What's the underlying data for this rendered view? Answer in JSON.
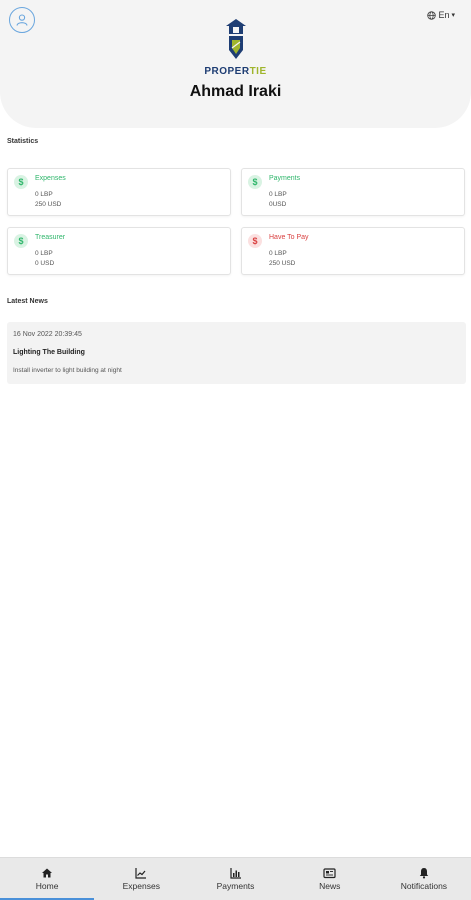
{
  "header": {
    "language": "En",
    "brand_part1": "PROPER",
    "brand_part2": "TIE",
    "username": "Ahmad Iraki"
  },
  "statistics": {
    "title": "Statistics",
    "cards": [
      {
        "icon": "dollar-icon",
        "label": "Expenses",
        "line1": "0 LBP",
        "line2": "250 USD",
        "color": "#2fb66b"
      },
      {
        "icon": "dollar-icon",
        "label": "Payments",
        "line1": "0 LBP",
        "line2": "0USD",
        "color": "#2fb66b"
      },
      {
        "icon": "dollar-icon",
        "label": "Treasurer",
        "line1": "0 LBP",
        "line2": "0 USD",
        "color": "#2fb66b"
      },
      {
        "icon": "dollar-icon",
        "label": "Have To Pay",
        "line1": "0 LBP",
        "line2": "250 USD",
        "color": "#d94040"
      }
    ]
  },
  "news": {
    "title": "Latest News",
    "items": [
      {
        "date": "16 Nov 2022 20:39:45",
        "title": "Lighting The Building",
        "description": "Install inverter to light building at night"
      }
    ]
  },
  "bottom_nav": {
    "items": [
      {
        "label": "Home",
        "icon": "home-icon",
        "active": true
      },
      {
        "label": "Expenses",
        "icon": "trend-chart-icon"
      },
      {
        "label": "Payments",
        "icon": "bar-chart-icon"
      },
      {
        "label": "News",
        "icon": "newspaper-icon"
      },
      {
        "label": "Notifications",
        "icon": "bell-icon"
      }
    ]
  },
  "colors": {
    "accent": "#4a90d9",
    "positive": "#2fb66b",
    "negative": "#d94040",
    "brand_navy": "#1e3d73",
    "brand_lime": "#9fb52c"
  }
}
